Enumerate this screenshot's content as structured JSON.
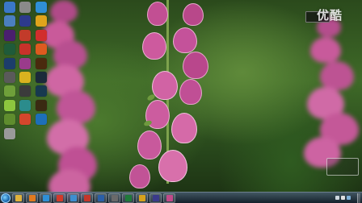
{
  "window": {
    "title": ""
  },
  "desktop": {
    "icons": [
      {
        "label": "",
        "icon": "app-icon",
        "color": "#3a78c8"
      },
      {
        "label": "",
        "icon": "media-player-icon",
        "color": "#8a8a8a"
      },
      {
        "label": "",
        "icon": "app-icon",
        "color": "#2f8fd6"
      },
      {
        "label": "",
        "icon": "app-icon",
        "color": "#4b7fbf"
      },
      {
        "label": "",
        "icon": "adobe-edge-icon",
        "color": "#2d3a8c"
      },
      {
        "label": "",
        "icon": "browser-icon",
        "color": "#e0a41b"
      },
      {
        "label": "",
        "icon": "adobe-premiere-icon",
        "color": "#4a1f6e"
      },
      {
        "label": "",
        "icon": "app-icon",
        "color": "#c23b2a"
      },
      {
        "label": "",
        "icon": "app-icon",
        "color": "#d12d2d"
      },
      {
        "label": "",
        "icon": "adobe-audition-icon",
        "color": "#1f5b3a"
      },
      {
        "label": "",
        "icon": "app-icon",
        "color": "#c8322a"
      },
      {
        "label": "",
        "icon": "app-icon",
        "color": "#dd5a1f"
      },
      {
        "label": "",
        "icon": "adobe-photoshop-icon",
        "color": "#1c3d6b"
      },
      {
        "label": "",
        "icon": "app-icon",
        "color": "#9a3b8c"
      },
      {
        "label": "",
        "icon": "adobe-illustrator-icon",
        "color": "#4a2a0e"
      },
      {
        "label": "",
        "icon": "app-icon",
        "color": "#5a5a5a"
      },
      {
        "label": "",
        "icon": "app-icon",
        "color": "#d9b21f"
      },
      {
        "label": "",
        "icon": "adobe-lightroom-icon",
        "color": "#1b2a3a"
      },
      {
        "label": "",
        "icon": "app-icon",
        "color": "#6fa03a"
      },
      {
        "label": "",
        "icon": "app-icon",
        "color": "#3b3b3b"
      },
      {
        "label": "",
        "icon": "adobe-prelude-icon",
        "color": "#17394f"
      },
      {
        "label": "",
        "icon": "app-icon",
        "color": "#8cc63e"
      },
      {
        "label": "",
        "icon": "app-icon",
        "color": "#2b8c8c"
      },
      {
        "label": "",
        "icon": "adobe-bridge-icon",
        "color": "#3a2a12"
      },
      {
        "label": "",
        "icon": "app-icon",
        "color": "#5f8d2e"
      },
      {
        "label": "",
        "icon": "app-icon",
        "color": "#d4462c"
      },
      {
        "label": "",
        "icon": "app-icon",
        "color": "#1d6fb8"
      },
      {
        "label": "",
        "icon": "app-icon",
        "color": "#9a9a9a"
      }
    ]
  },
  "overlays": {
    "watermark": "优酷",
    "tray_widget_lines": [
      "",
      ""
    ],
    "signature": ""
  },
  "taskbar": {
    "pinned": [
      {
        "icon": "folder-icon",
        "color": "#e0b23c"
      },
      {
        "icon": "media-player-icon",
        "color": "#e07a1f"
      },
      {
        "icon": "browser-icon",
        "color": "#2f8fd6"
      },
      {
        "icon": "app-icon",
        "color": "#d23a2a"
      },
      {
        "icon": "app-icon",
        "color": "#3e8ed0"
      },
      {
        "icon": "app-icon",
        "color": "#c4362a"
      },
      {
        "icon": "app-icon",
        "color": "#2a5fa8"
      },
      {
        "icon": "app-icon",
        "color": "#6a6a6a"
      },
      {
        "icon": "app-icon",
        "color": "#1f7a3a"
      },
      {
        "icon": "app-icon",
        "color": "#d6a21c"
      },
      {
        "icon": "app-icon",
        "color": "#3a3a8a"
      },
      {
        "icon": "app-icon",
        "color": "#c24a8a"
      }
    ],
    "tray": {
      "lang": "",
      "time": "",
      "date": ""
    }
  },
  "colors": {
    "flower": "#c9589a",
    "flower_light": "#e7a6cc",
    "flower_dark": "#8c2f6a",
    "foliage": "#3f6a28"
  }
}
